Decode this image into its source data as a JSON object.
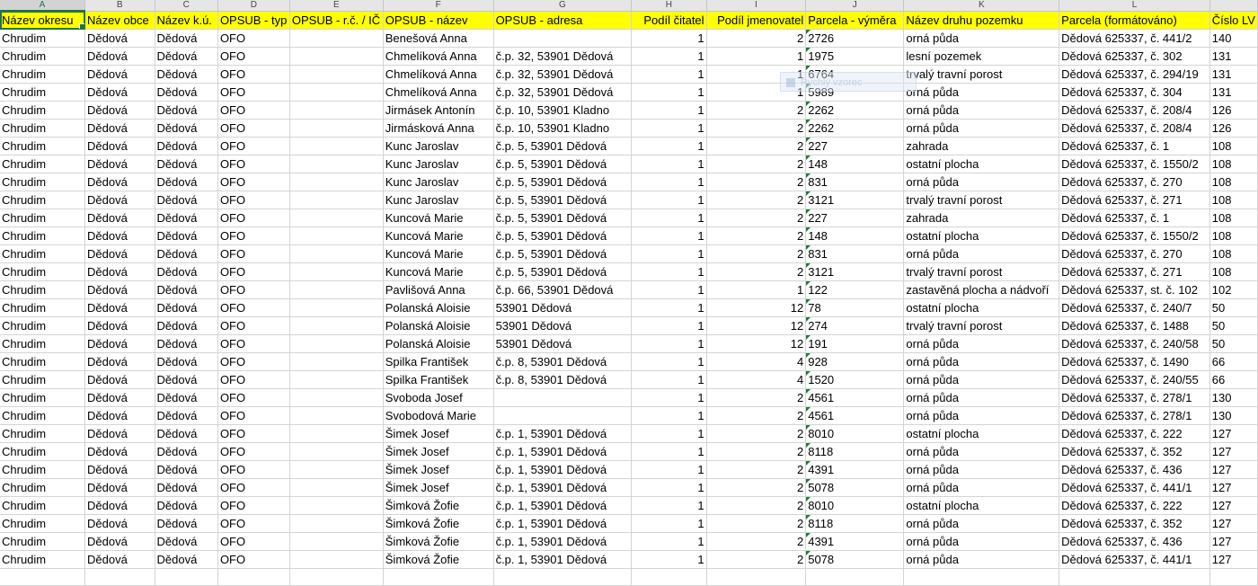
{
  "columns": [
    {
      "letter": "A",
      "width": 96
    },
    {
      "letter": "B",
      "width": 78
    },
    {
      "letter": "C",
      "width": 71
    },
    {
      "letter": "D",
      "width": 80
    },
    {
      "letter": "E",
      "width": 104
    },
    {
      "letter": "F",
      "width": 125
    },
    {
      "letter": "G",
      "width": 156
    },
    {
      "letter": "H",
      "width": 85
    },
    {
      "letter": "I",
      "width": 112
    },
    {
      "letter": "J",
      "width": 110
    },
    {
      "letter": "K",
      "width": 174
    },
    {
      "letter": "L",
      "width": 169
    },
    {
      "letter": "",
      "width": 40
    }
  ],
  "header_row": [
    "Název okresu",
    "Název obce",
    "Název k.ú.",
    "OPSUB - typ",
    "OPSUB - r.č. / IČ",
    "OPSUB - název",
    "OPSUB  - adresa",
    "Podíl čitatel",
    "Podíl jmenovatel",
    "Parcela - výměra",
    "Název druhu pozemku",
    "Parcela (formátováno)",
    "Číslo LV"
  ],
  "ghost_tooltip": "Rychlý vzorec",
  "rows": [
    [
      "Chrudim",
      "Dědová",
      "Dědová",
      "OFO",
      "",
      "Benešová Anna",
      "",
      "1",
      "2",
      "2726",
      "orná půda",
      "Dědová 625337, č. 441/2",
      "140"
    ],
    [
      "Chrudim",
      "Dědová",
      "Dědová",
      "OFO",
      "",
      "Chmelíková Anna",
      "č.p. 32, 53901 Dědová",
      "1",
      "1",
      "1975",
      "lesní pozemek",
      "Dědová 625337, č. 302",
      "131"
    ],
    [
      "Chrudim",
      "Dědová",
      "Dědová",
      "OFO",
      "",
      "Chmelíková Anna",
      "č.p. 32, 53901 Dědová",
      "1",
      "1",
      "6764",
      "trvalý travní porost",
      "Dědová 625337, č. 294/19",
      "131"
    ],
    [
      "Chrudim",
      "Dědová",
      "Dědová",
      "OFO",
      "",
      "Chmelíková Anna",
      "č.p. 32, 53901 Dědová",
      "1",
      "1",
      "5989",
      "orná půda",
      "Dědová 625337, č. 304",
      "131"
    ],
    [
      "Chrudim",
      "Dědová",
      "Dědová",
      "OFO",
      "",
      "Jirmásek Antonín",
      "č.p. 10, 53901 Kladno",
      "1",
      "2",
      "2262",
      "orná půda",
      "Dědová 625337, č. 208/4",
      "126"
    ],
    [
      "Chrudim",
      "Dědová",
      "Dědová",
      "OFO",
      "",
      "Jirmásková Anna",
      "č.p. 10, 53901 Kladno",
      "1",
      "2",
      "2262",
      "orná půda",
      "Dědová 625337, č. 208/4",
      "126"
    ],
    [
      "Chrudim",
      "Dědová",
      "Dědová",
      "OFO",
      "",
      "Kunc Jaroslav",
      "č.p. 5, 53901 Dědová",
      "1",
      "2",
      "227",
      "zahrada",
      "Dědová 625337, č. 1",
      "108"
    ],
    [
      "Chrudim",
      "Dědová",
      "Dědová",
      "OFO",
      "",
      "Kunc Jaroslav",
      "č.p. 5, 53901 Dědová",
      "1",
      "2",
      "148",
      "ostatní plocha",
      "Dědová 625337, č. 1550/2",
      "108"
    ],
    [
      "Chrudim",
      "Dědová",
      "Dědová",
      "OFO",
      "",
      "Kunc Jaroslav",
      "č.p. 5, 53901 Dědová",
      "1",
      "2",
      "831",
      "orná půda",
      "Dědová 625337, č. 270",
      "108"
    ],
    [
      "Chrudim",
      "Dědová",
      "Dědová",
      "OFO",
      "",
      "Kunc Jaroslav",
      "č.p. 5, 53901 Dědová",
      "1",
      "2",
      "3121",
      "trvalý travní porost",
      "Dědová 625337, č. 271",
      "108"
    ],
    [
      "Chrudim",
      "Dědová",
      "Dědová",
      "OFO",
      "",
      "Kuncová Marie",
      "č.p. 5, 53901 Dědová",
      "1",
      "2",
      "227",
      "zahrada",
      "Dědová 625337, č. 1",
      "108"
    ],
    [
      "Chrudim",
      "Dědová",
      "Dědová",
      "OFO",
      "",
      "Kuncová Marie",
      "č.p. 5, 53901 Dědová",
      "1",
      "2",
      "148",
      "ostatní plocha",
      "Dědová 625337, č. 1550/2",
      "108"
    ],
    [
      "Chrudim",
      "Dědová",
      "Dědová",
      "OFO",
      "",
      "Kuncová Marie",
      "č.p. 5, 53901 Dědová",
      "1",
      "2",
      "831",
      "orná půda",
      "Dědová 625337, č. 270",
      "108"
    ],
    [
      "Chrudim",
      "Dědová",
      "Dědová",
      "OFO",
      "",
      "Kuncová Marie",
      "č.p. 5, 53901 Dědová",
      "1",
      "2",
      "3121",
      "trvalý travní porost",
      "Dědová 625337, č. 271",
      "108"
    ],
    [
      "Chrudim",
      "Dědová",
      "Dědová",
      "OFO",
      "",
      "Pavlišová Anna",
      "č.p. 66, 53901 Dědová",
      "1",
      "1",
      "122",
      "zastavěná plocha a nádvoří",
      "Dědová 625337, st. č. 102",
      "102"
    ],
    [
      "Chrudim",
      "Dědová",
      "Dědová",
      "OFO",
      "",
      "Polanská Aloisie",
      "53901 Dědová",
      "1",
      "12",
      "78",
      "ostatní plocha",
      "Dědová 625337, č. 240/7",
      "50"
    ],
    [
      "Chrudim",
      "Dědová",
      "Dědová",
      "OFO",
      "",
      "Polanská Aloisie",
      "53901 Dědová",
      "1",
      "12",
      "274",
      "trvalý travní porost",
      "Dědová 625337, č. 1488",
      "50"
    ],
    [
      "Chrudim",
      "Dědová",
      "Dědová",
      "OFO",
      "",
      "Polanská Aloisie",
      "53901 Dědová",
      "1",
      "12",
      "191",
      "orná půda",
      "Dědová 625337, č. 240/58",
      "50"
    ],
    [
      "Chrudim",
      "Dědová",
      "Dědová",
      "OFO",
      "",
      "Spilka František",
      "č.p. 8, 53901 Dědová",
      "1",
      "4",
      "928",
      "orná půda",
      "Dědová 625337, č. 1490",
      "66"
    ],
    [
      "Chrudim",
      "Dědová",
      "Dědová",
      "OFO",
      "",
      "Spilka František",
      "č.p. 8, 53901 Dědová",
      "1",
      "4",
      "1520",
      "orná půda",
      "Dědová 625337, č. 240/55",
      "66"
    ],
    [
      "Chrudim",
      "Dědová",
      "Dědová",
      "OFO",
      "",
      "Svoboda Josef",
      "",
      "1",
      "2",
      "4561",
      "orná půda",
      "Dědová 625337, č. 278/1",
      "130"
    ],
    [
      "Chrudim",
      "Dědová",
      "Dědová",
      "OFO",
      "",
      "Svobodová Marie",
      "",
      "1",
      "2",
      "4561",
      "orná půda",
      "Dědová 625337, č. 278/1",
      "130"
    ],
    [
      "Chrudim",
      "Dědová",
      "Dědová",
      "OFO",
      "",
      "Šimek Josef",
      "č.p. 1, 53901 Dědová",
      "1",
      "2",
      "8010",
      "ostatní plocha",
      "Dědová 625337, č. 222",
      "127"
    ],
    [
      "Chrudim",
      "Dědová",
      "Dědová",
      "OFO",
      "",
      "Šimek Josef",
      "č.p. 1, 53901 Dědová",
      "1",
      "2",
      "8118",
      "orná půda",
      "Dědová 625337, č. 352",
      "127"
    ],
    [
      "Chrudim",
      "Dědová",
      "Dědová",
      "OFO",
      "",
      "Šimek Josef",
      "č.p. 1, 53901 Dědová",
      "1",
      "2",
      "4391",
      "orná půda",
      "Dědová 625337, č. 436",
      "127"
    ],
    [
      "Chrudim",
      "Dědová",
      "Dědová",
      "OFO",
      "",
      "Šimek Josef",
      "č.p. 1, 53901 Dědová",
      "1",
      "2",
      "5078",
      "orná půda",
      "Dědová 625337, č. 441/1",
      "127"
    ],
    [
      "Chrudim",
      "Dědová",
      "Dědová",
      "OFO",
      "",
      "Šimková Žofie",
      "č.p. 1, 53901 Dědová",
      "1",
      "2",
      "8010",
      "ostatní plocha",
      "Dědová 625337, č. 222",
      "127"
    ],
    [
      "Chrudim",
      "Dědová",
      "Dědová",
      "OFO",
      "",
      "Šimková Žofie",
      "č.p. 1, 53901 Dědová",
      "1",
      "2",
      "8118",
      "orná půda",
      "Dědová 625337, č. 352",
      "127"
    ],
    [
      "Chrudim",
      "Dědová",
      "Dědová",
      "OFO",
      "",
      "Šimková Žofie",
      "č.p. 1, 53901 Dědová",
      "1",
      "2",
      "4391",
      "orná půda",
      "Dědová 625337, č. 436",
      "127"
    ],
    [
      "Chrudim",
      "Dědová",
      "Dědová",
      "OFO",
      "",
      "Šimková Žofie",
      "č.p. 1, 53901 Dědová",
      "1",
      "2",
      "5078",
      "orná půda",
      "Dědová 625337, č. 441/1",
      "127"
    ],
    [
      "",
      "",
      "",
      "",
      "",
      "",
      "",
      "",
      "",
      "",
      "",
      "",
      ""
    ]
  ],
  "selected_cell": "A1",
  "colors": {
    "header_fill": "#ffff00",
    "selection": "#217346",
    "comment_marker": "#1e7a3c",
    "gridline": "#d4d4d4"
  }
}
